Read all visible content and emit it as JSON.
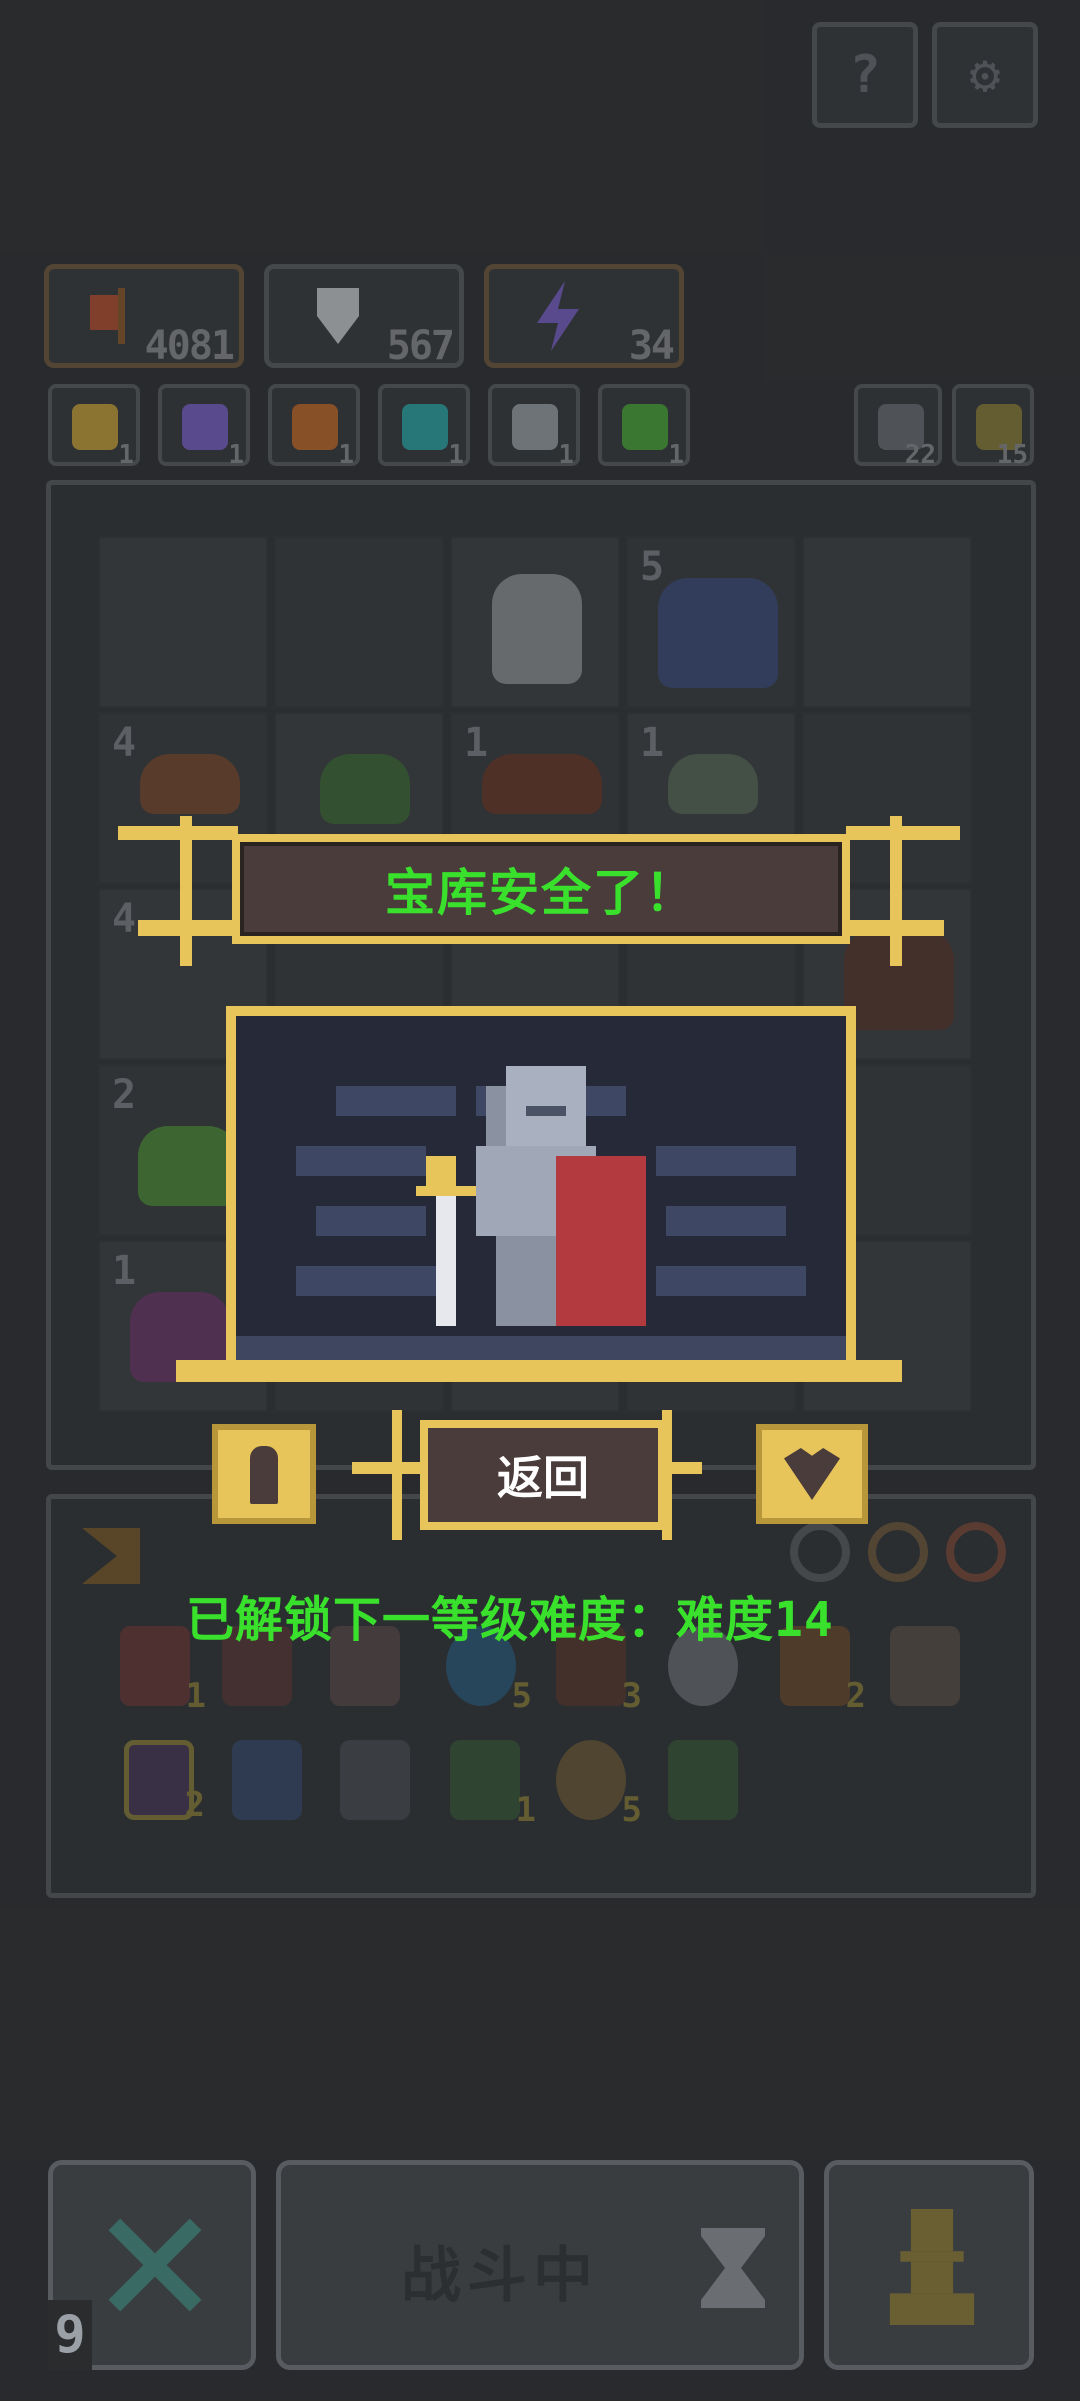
{
  "top_buttons": {
    "help_glyph": "?",
    "settings_glyph": "⚙"
  },
  "resources": [
    {
      "name": "attack",
      "value": "4081",
      "icon": "axe-icon",
      "color": "#b5502f"
    },
    {
      "name": "defense",
      "value": "567",
      "icon": "shield-icon",
      "color": "#c9ccce"
    },
    {
      "name": "energy",
      "value": "34",
      "icon": "lightning-icon",
      "color": "#7a62c8"
    }
  ],
  "buffs": [
    {
      "icon": "arrow-up-icon",
      "count": "1",
      "color": "#c7a23a"
    },
    {
      "icon": "lightning-icon",
      "count": "1",
      "color": "#7a62c8"
    },
    {
      "icon": "arrow-down-icon",
      "count": "1",
      "color": "#c06a2a"
    },
    {
      "icon": "clock-icon",
      "count": "1",
      "color": "#2fa6a6"
    },
    {
      "icon": "swords-icon",
      "count": "1",
      "color": "#9aa0a6"
    },
    {
      "icon": "leaf-icon",
      "count": "1",
      "color": "#4aa83a"
    }
  ],
  "side_counters": [
    {
      "icon": "undo-icon",
      "value": "22"
    },
    {
      "icon": "pawn-icon",
      "value": "15"
    }
  ],
  "board": {
    "levels": [
      "5",
      "4",
      "1",
      "1",
      "4",
      "2",
      "1"
    ]
  },
  "modal": {
    "title": "宝库安全了！",
    "return_label": "返回",
    "left_icon": "pawn-icon",
    "right_icon": "heart-gem-icon"
  },
  "unlock_message": "已解锁下一等级难度：难度14",
  "inventory": {
    "counts": [
      "1",
      "5",
      "3",
      "2",
      "2",
      "1",
      "5"
    ]
  },
  "bottom_bar": {
    "status": "战斗中",
    "turn_count": "9",
    "cancel_icon": "cross-icon",
    "hourglass_icon": "hourglass-icon",
    "hero_icon": "pawn-icon"
  }
}
